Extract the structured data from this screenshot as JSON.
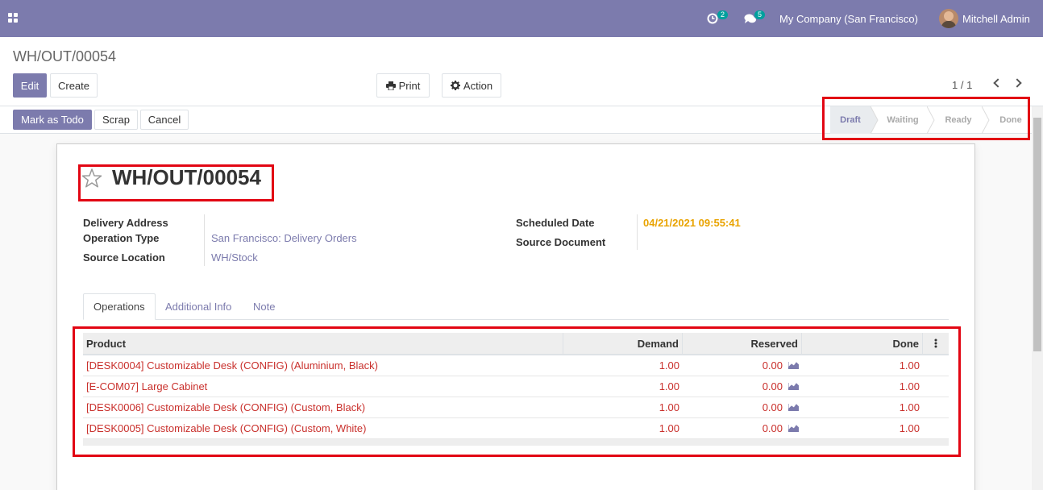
{
  "navbar": {
    "activity_count": "2",
    "messages_count": "5",
    "company": "My Company (San Francisco)",
    "user": "Mitchell Admin"
  },
  "control": {
    "breadcrumb": "WH/OUT/00054",
    "edit_label": "Edit",
    "create_label": "Create",
    "print_label": "Print",
    "action_label": "Action",
    "pager": "1 / 1"
  },
  "statusbar": {
    "mark_todo_label": "Mark as Todo",
    "scrap_label": "Scrap",
    "cancel_label": "Cancel",
    "stages": [
      "Draft",
      "Waiting",
      "Ready",
      "Done"
    ],
    "current_stage": "Draft"
  },
  "record": {
    "title": "WH/OUT/00054",
    "fields_left": [
      {
        "label": "Delivery Address",
        "value": ""
      },
      {
        "label": "Operation Type",
        "value": "San Francisco: Delivery Orders"
      },
      {
        "label": "Source Location",
        "value": "WH/Stock"
      }
    ],
    "fields_right": [
      {
        "label": "Scheduled Date",
        "value": "04/21/2021 09:55:41"
      },
      {
        "label": "Source Document",
        "value": ""
      }
    ]
  },
  "tabs": [
    "Operations",
    "Additional Info",
    "Note"
  ],
  "table": {
    "headers": [
      "Product",
      "Demand",
      "Reserved",
      "Done"
    ],
    "rows": [
      {
        "product": "[DESK0004] Customizable Desk (CONFIG) (Aluminium, Black)",
        "demand": "1.00",
        "reserved": "0.00",
        "done": "1.00"
      },
      {
        "product": "[E-COM07] Large Cabinet",
        "demand": "1.00",
        "reserved": "0.00",
        "done": "1.00"
      },
      {
        "product": "[DESK0006] Customizable Desk (CONFIG) (Custom, Black)",
        "demand": "1.00",
        "reserved": "0.00",
        "done": "1.00"
      },
      {
        "product": "[DESK0005] Customizable Desk (CONFIG) (Custom, White)",
        "demand": "1.00",
        "reserved": "0.00",
        "done": "1.00"
      }
    ]
  },
  "colors": {
    "brand": "#7c7bad",
    "highlight": "#e20613",
    "date": "#e9a300",
    "row_text": "#c9302c"
  }
}
